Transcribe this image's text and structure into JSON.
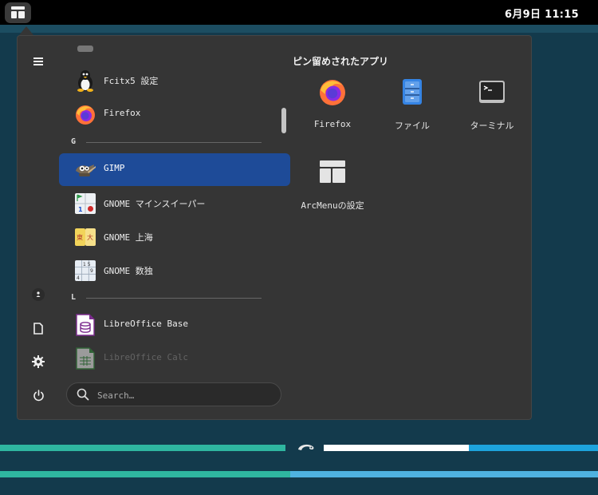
{
  "topbar": {
    "clock": "6月9日  11:15",
    "arcmenu_button_icon": "arcmenu-layout-icon"
  },
  "sidebar": {
    "buttons": [
      {
        "icon": "hamburger-menu-icon"
      },
      {
        "icon": "user-avatar-icon"
      },
      {
        "icon": "documents-icon"
      },
      {
        "icon": "settings-gear-icon"
      },
      {
        "icon": "power-icon"
      }
    ]
  },
  "applist": {
    "items": [
      {
        "label": "Fcitx5 設定",
        "icon": "tux-penguin-icon"
      },
      {
        "label": "Firefox",
        "icon": "firefox-icon"
      },
      {
        "group": "G"
      },
      {
        "label": "GIMP",
        "icon": "gimp-icon",
        "selected": true
      },
      {
        "label": "GNOME マインスイーパー",
        "icon": "mines-icon"
      },
      {
        "label": "GNOME 上海",
        "icon": "mahjongg-icon"
      },
      {
        "label": "GNOME 数独",
        "icon": "sudoku-icon"
      },
      {
        "group": "L"
      },
      {
        "label": "LibreOffice Base",
        "icon": "libreoffice-base-icon"
      },
      {
        "label": "LibreOffice Calc",
        "icon": "libreoffice-calc-icon"
      }
    ]
  },
  "pinned": {
    "title": "ピン留めされたアプリ",
    "apps": [
      {
        "label": "Firefox",
        "icon": "firefox-icon"
      },
      {
        "label": "ファイル",
        "icon": "files-icon"
      },
      {
        "label": "ターミナル",
        "icon": "terminal-icon"
      },
      {
        "label": "ArcMenuの設定",
        "icon": "arcmenu-settings-icon"
      }
    ]
  },
  "search": {
    "placeholder": "Search…",
    "value": ""
  },
  "colors": {
    "selected": "#1e4b98",
    "menu_bg": "#353535",
    "desktop": "#133a4c",
    "teal": "#2fb6a0",
    "blue": "#4fb2e0"
  }
}
